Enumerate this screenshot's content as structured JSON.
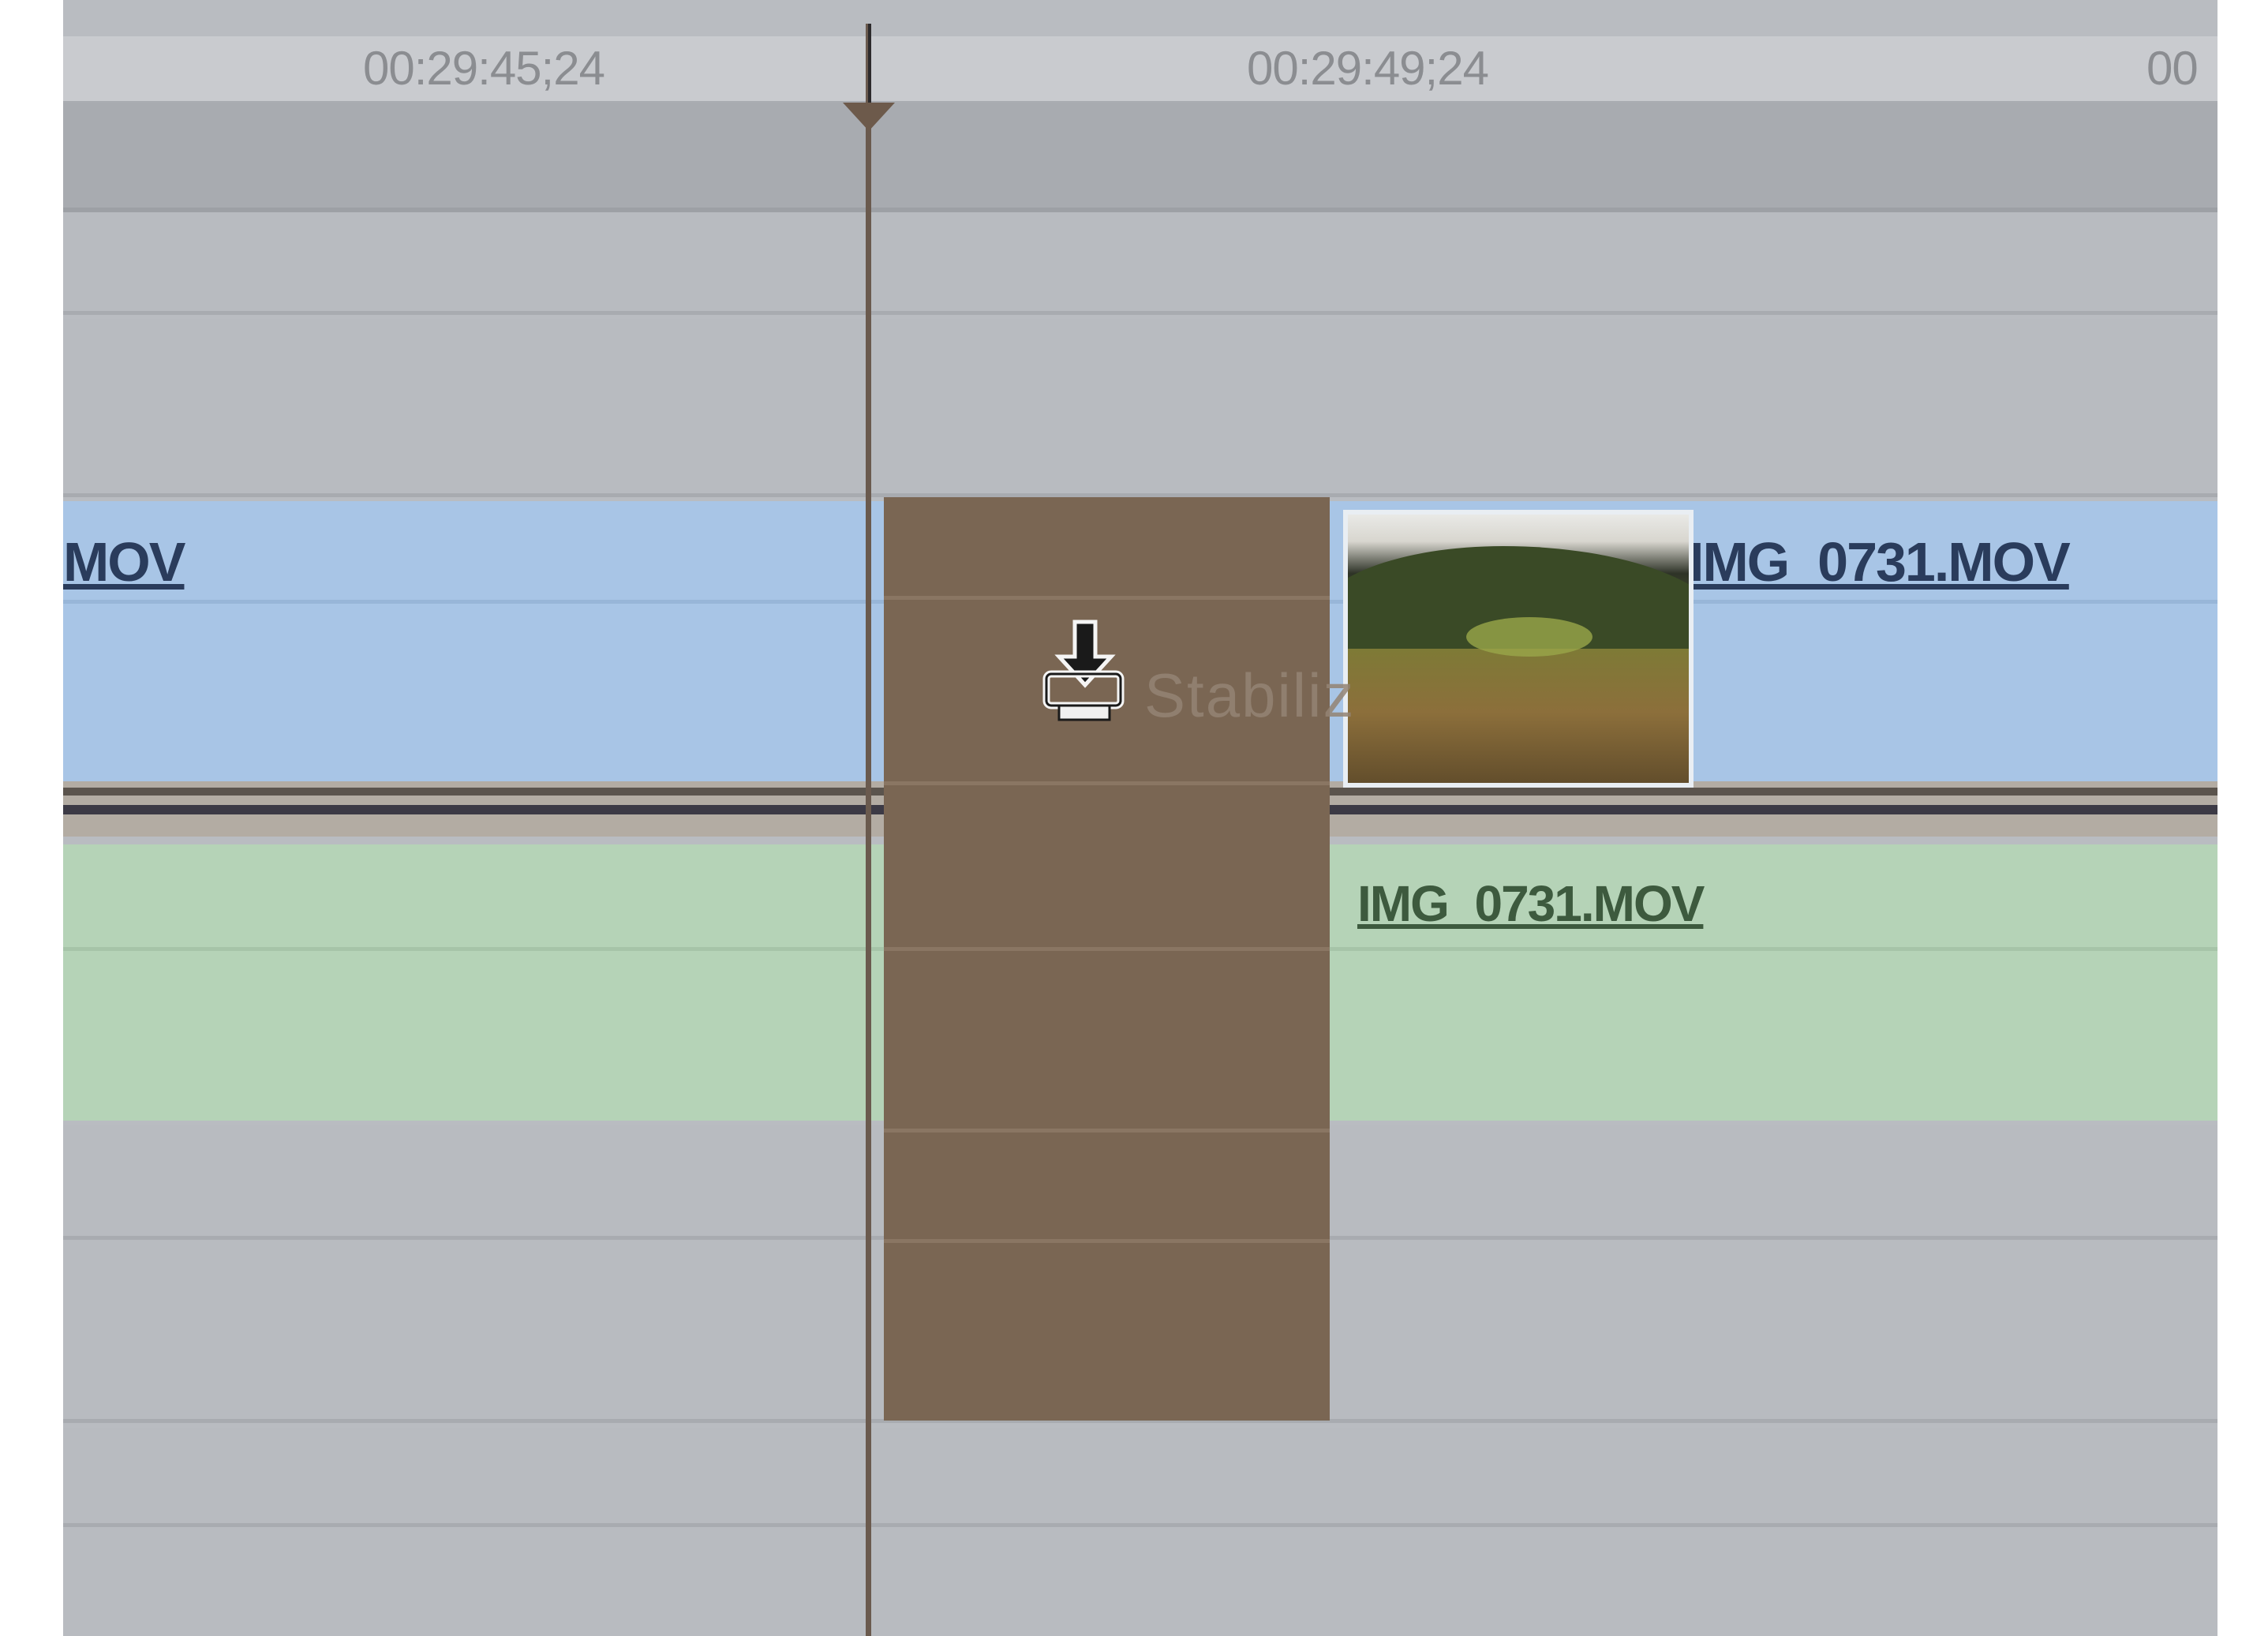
{
  "ruler": {
    "timecodes": [
      "00:29:45;24",
      "00:29:49;24",
      "00"
    ]
  },
  "clips": {
    "video_left_label": "MOV",
    "video_right_label": "IMG_0731.MOV",
    "audio_right_label": "IMG_0731.MOV"
  },
  "drop_overlay": {
    "icon": "edit-insert-cursor-icon",
    "ghost_text": "Stabiliz"
  },
  "colors": {
    "video_track": "#a8c5e6",
    "audio_track": "#b5d3b7",
    "gap_highlight": "#7a6653",
    "playhead": "#6a5a4e"
  }
}
